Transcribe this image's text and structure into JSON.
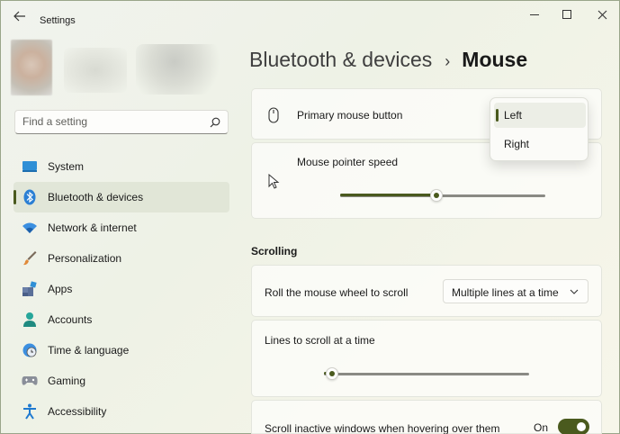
{
  "app": {
    "title": "Settings"
  },
  "search": {
    "placeholder": "Find a setting"
  },
  "sidebar": {
    "items": [
      {
        "label": "System",
        "icon": "monitor-icon"
      },
      {
        "label": "Bluetooth & devices",
        "icon": "bluetooth-icon",
        "selected": true
      },
      {
        "label": "Network & internet",
        "icon": "wifi-icon"
      },
      {
        "label": "Personalization",
        "icon": "brush-icon"
      },
      {
        "label": "Apps",
        "icon": "apps-icon"
      },
      {
        "label": "Accounts",
        "icon": "person-icon"
      },
      {
        "label": "Time & language",
        "icon": "globe-clock-icon"
      },
      {
        "label": "Gaming",
        "icon": "gamepad-icon"
      },
      {
        "label": "Accessibility",
        "icon": "accessibility-icon"
      }
    ]
  },
  "breadcrumb": {
    "parent": "Bluetooth & devices",
    "separator": "›",
    "current": "Mouse"
  },
  "settings": {
    "primary_button": {
      "label": "Primary mouse button",
      "options": [
        "Left",
        "Right"
      ],
      "selected": "Left"
    },
    "pointer_speed": {
      "label": "Mouse pointer speed",
      "value_fraction": 0.47
    },
    "scrolling_heading": "Scrolling",
    "roll_wheel": {
      "label": "Roll the mouse wheel to scroll",
      "value": "Multiple lines at a time"
    },
    "lines_to_scroll": {
      "label": "Lines to scroll at a time",
      "value_fraction": 0.04
    },
    "scroll_inactive": {
      "label": "Scroll inactive windows when hovering over them",
      "state": "On",
      "on": true
    }
  },
  "colors": {
    "accent": "#4a5a1e"
  }
}
